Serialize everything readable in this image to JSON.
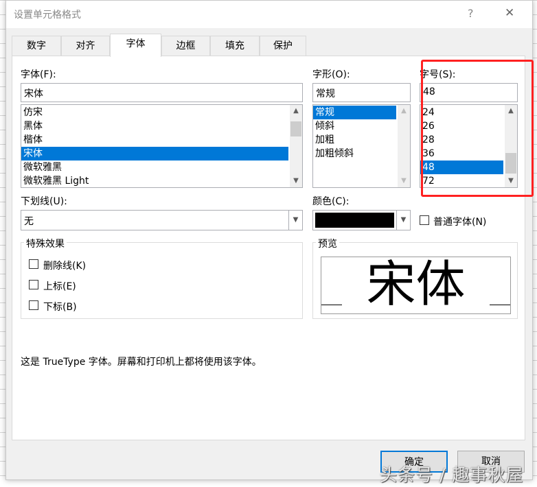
{
  "title": "设置单元格格式",
  "help": "?",
  "close": "✕",
  "tabs": [
    "数字",
    "对齐",
    "字体",
    "边框",
    "填充",
    "保护"
  ],
  "font": {
    "label": "字体(F):",
    "value": "宋体",
    "items": [
      "仿宋",
      "黑体",
      "楷体",
      "宋体",
      "微软雅黑",
      "微软雅黑 Light"
    ],
    "selected": 3
  },
  "style": {
    "label": "字形(O):",
    "value": "常规",
    "items": [
      "常规",
      "倾斜",
      "加粗",
      "加粗倾斜"
    ],
    "selected": 0
  },
  "size": {
    "label": "字号(S):",
    "value": "48",
    "items": [
      "24",
      "26",
      "28",
      "36",
      "48",
      "72"
    ],
    "selected": 4
  },
  "underline": {
    "label": "下划线(U):",
    "value": "无"
  },
  "color": {
    "label": "颜色(C):",
    "value": "#000000"
  },
  "normal_font": "普通字体(N)",
  "effects": {
    "title": "特殊效果",
    "items": [
      "删除线(K)",
      "上标(E)",
      "下标(B)"
    ]
  },
  "preview": {
    "title": "预览",
    "text": "宋体"
  },
  "info": "这是 TrueType 字体。屏幕和打印机上都将使用该字体。",
  "buttons": {
    "ok": "确定",
    "cancel": "取消"
  },
  "watermark": "头条号 / 趣事秋屋"
}
